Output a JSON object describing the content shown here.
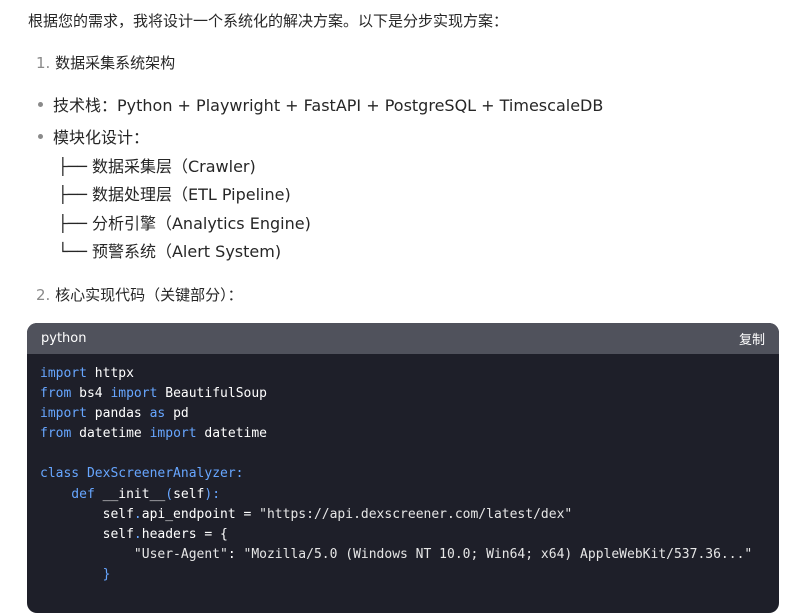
{
  "intro": "根据您的需求，我将设计一个系统化的解决方案。以下是分步实现方案：",
  "section1": {
    "num": "1.",
    "title": "数据采集系统架构"
  },
  "bullets": [
    {
      "text": "技术栈：Python + Playwright + FastAPI + PostgreSQL + TimescaleDB"
    },
    {
      "text": "模块化设计："
    }
  ],
  "tree": [
    "├── 数据采集层（Crawler)",
    "├── 数据处理层（ETL Pipeline)",
    "├── 分析引擎（Analytics Engine)",
    "└── 预警系统（Alert System)"
  ],
  "section2": {
    "num": "2.",
    "title": "核心实现代码（关键部分）："
  },
  "code": {
    "language": "python",
    "copy_label": "复制",
    "lines": [
      [
        {
          "t": "import",
          "c": "kw"
        },
        {
          "t": " httpx",
          "c": "plain"
        }
      ],
      [
        {
          "t": "from",
          "c": "kw"
        },
        {
          "t": " bs4 ",
          "c": "plain"
        },
        {
          "t": "import",
          "c": "kw"
        },
        {
          "t": " BeautifulSoup",
          "c": "plain"
        }
      ],
      [
        {
          "t": "import",
          "c": "kw"
        },
        {
          "t": " pandas ",
          "c": "plain"
        },
        {
          "t": "as",
          "c": "kw"
        },
        {
          "t": " pd",
          "c": "plain"
        }
      ],
      [
        {
          "t": "from",
          "c": "kw"
        },
        {
          "t": " datetime ",
          "c": "plain"
        },
        {
          "t": "import",
          "c": "kw"
        },
        {
          "t": " datetime",
          "c": "plain"
        }
      ],
      [
        {
          "t": "",
          "c": "plain"
        }
      ],
      [
        {
          "t": "class",
          "c": "kw"
        },
        {
          "t": " DexScreenerAnalyzer:",
          "c": "kw"
        }
      ],
      [
        {
          "t": "    def",
          "c": "kw"
        },
        {
          "t": " __init__",
          "c": "plain"
        },
        {
          "t": "(",
          "c": "kw"
        },
        {
          "t": "self",
          "c": "plain"
        },
        {
          "t": "):",
          "c": "kw"
        }
      ],
      [
        {
          "t": "        self",
          "c": "plain"
        },
        {
          "t": ".",
          "c": "kw"
        },
        {
          "t": "api_endpoint",
          "c": "plain"
        },
        {
          "t": " = ",
          "c": "plain"
        },
        {
          "t": "\"https://api.dexscreener.com/latest/dex\"",
          "c": "str"
        }
      ],
      [
        {
          "t": "        self",
          "c": "plain"
        },
        {
          "t": ".",
          "c": "kw"
        },
        {
          "t": "headers",
          "c": "plain"
        },
        {
          "t": " = {",
          "c": "plain"
        }
      ],
      [
        {
          "t": "            \"User-Agent\"",
          "c": "str"
        },
        {
          "t": ": ",
          "c": "plain"
        },
        {
          "t": "\"Mozilla/5.0 (Windows NT 10.0; Win64; x64) AppleWebKit/537.36...\"",
          "c": "str"
        }
      ],
      [
        {
          "t": "        }",
          "c": "kw"
        }
      ]
    ]
  },
  "colors": {
    "code_bg": "#1e1f29",
    "code_header_bg": "#50525c",
    "keyword": "#67a6ff"
  }
}
